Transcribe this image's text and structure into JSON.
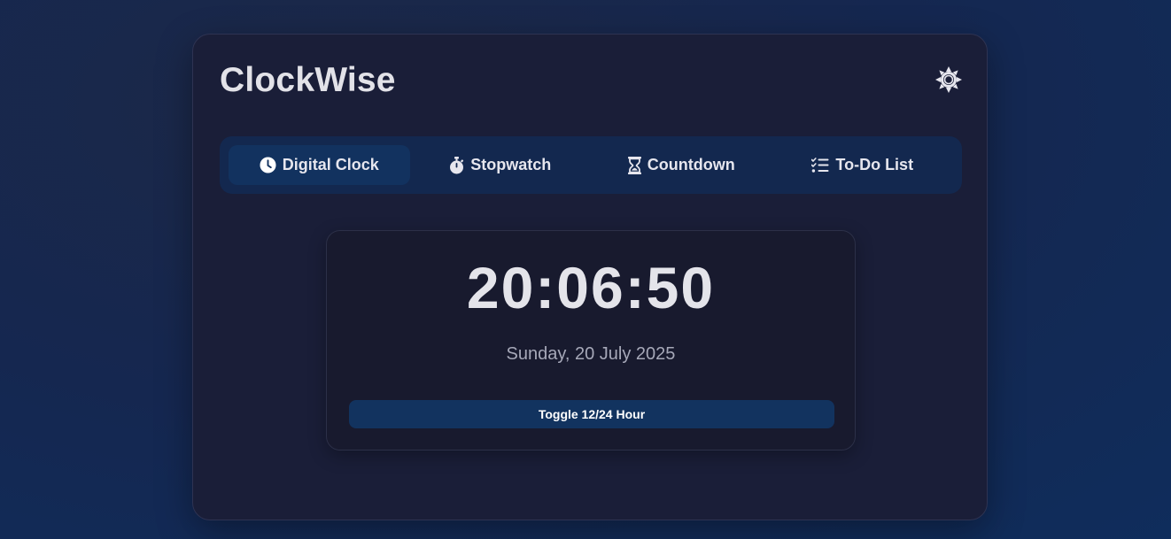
{
  "app": {
    "title": "ClockWise"
  },
  "header": {
    "theme_toggle_icon": "sun-icon"
  },
  "tabs": [
    {
      "label": "Digital Clock",
      "icon": "clock-icon",
      "active": true
    },
    {
      "label": "Stopwatch",
      "icon": "stopwatch-icon",
      "active": false
    },
    {
      "label": "Countdown",
      "icon": "hourglass-icon",
      "active": false
    },
    {
      "label": "To-Do List",
      "icon": "list-check-icon",
      "active": false
    }
  ],
  "clock": {
    "time": "20:06:50",
    "date": "Sunday, 20 July 2025",
    "toggle_label": "Toggle 12/24 Hour"
  },
  "colors": {
    "background": "#152750",
    "card": "#1a1e38",
    "tab_bar": "#13284f",
    "active_tab": "#12325f",
    "text": "#e4e4ea",
    "muted_text": "#a6a8b8"
  }
}
